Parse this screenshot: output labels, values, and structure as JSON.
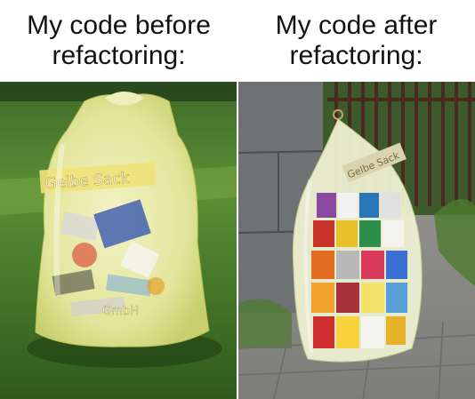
{
  "meme": {
    "left_caption": "My code before\nrefactoring:",
    "right_caption": "My code after\nrefactoring:"
  },
  "left_bag": {
    "label": "Gelbe Sack",
    "maker": "GmbH"
  },
  "right_bag": {
    "label": "Gelbe Sack"
  }
}
